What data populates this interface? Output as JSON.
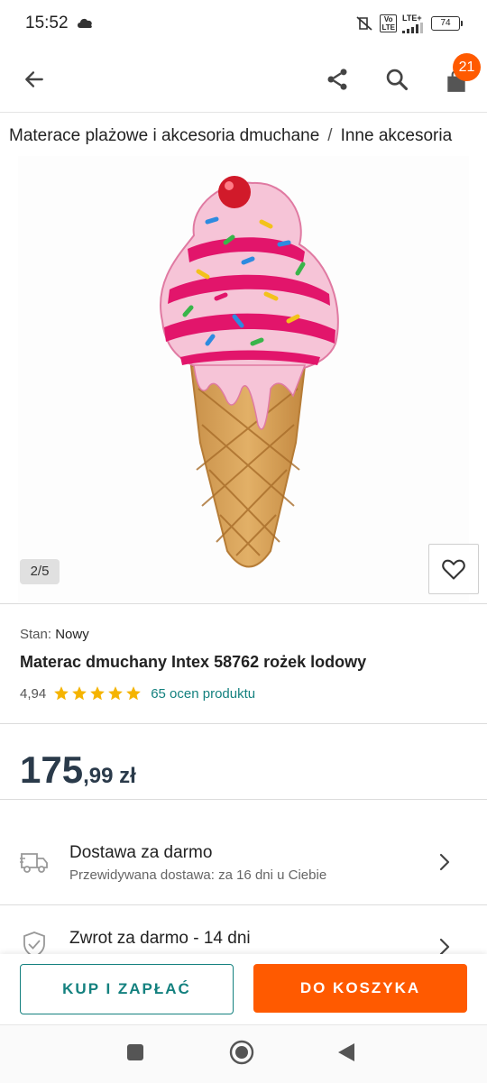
{
  "status_bar": {
    "time": "15:52",
    "volte": "Vo\nLTE",
    "network": "LTE+",
    "battery": "74",
    "icons": [
      "cloud-icon",
      "mute-icon",
      "signal-icon",
      "battery-icon"
    ]
  },
  "appbar": {
    "icons": [
      "back-arrow-icon",
      "share-icon",
      "search-icon",
      "cart-icon"
    ],
    "cart_count": "21"
  },
  "breadcrumb": {
    "items": [
      "Materace plażowe i akcesoria dmuchane",
      "Inne akcesoria"
    ],
    "separator": "/"
  },
  "gallery": {
    "counter": "2/5",
    "image_icon": "ice-cream-float-image",
    "favorite_icon": "heart-icon"
  },
  "product": {
    "condition_label": "Stan:",
    "condition_value": "Nowy",
    "title": "Materac dmuchany Intex 58762 rożek lodowy",
    "rating_value": "4,94",
    "rating_stars": 5,
    "reviews": "65 ocen produktu",
    "price_int": "175",
    "price_rest": ",99 zł"
  },
  "delivery": {
    "title": "Dostawa za darmo",
    "subtitle": "Przewidywana dostawa: za 16 dni u Ciebie",
    "icon": "truck-icon"
  },
  "returns": {
    "title": "Zwrot za darmo - 14 dni",
    "icon": "shield-check-icon"
  },
  "actions": {
    "buy_label": "KUP I ZAPŁAĆ",
    "cart_label": "DO KOSZYKA"
  },
  "system_nav": {
    "icons": [
      "recents-icon",
      "home-icon",
      "back-icon"
    ]
  },
  "colors": {
    "accent_orange": "#ff5a00",
    "accent_teal": "#14817f",
    "star": "#f5b400",
    "price": "#2a3a4a"
  }
}
